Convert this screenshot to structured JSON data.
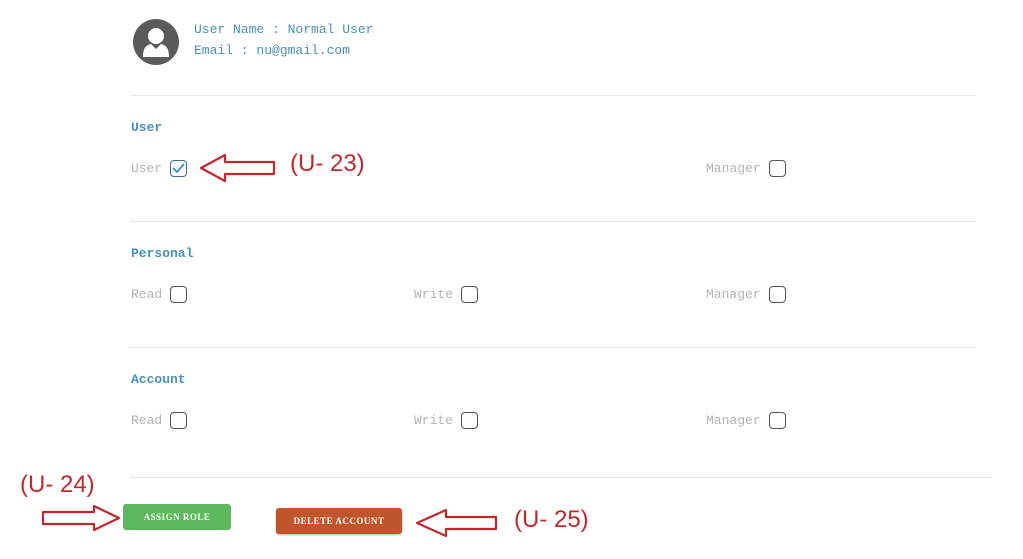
{
  "user": {
    "name_line": "User Name : Normal User",
    "email_line": "Email : nu@gmail.com",
    "avatar_icon": "user-avatar-icon"
  },
  "sections": [
    {
      "title": "User",
      "permissions": [
        {
          "label": "User",
          "checked": true
        },
        {
          "label": "Manager",
          "checked": false
        }
      ]
    },
    {
      "title": "Personal",
      "permissions": [
        {
          "label": "Read",
          "checked": false
        },
        {
          "label": "Write",
          "checked": false
        },
        {
          "label": "Manager",
          "checked": false
        }
      ]
    },
    {
      "title": "Account",
      "permissions": [
        {
          "label": "Read",
          "checked": false
        },
        {
          "label": "Write",
          "checked": false
        },
        {
          "label": "Manager",
          "checked": false
        }
      ]
    }
  ],
  "buttons": {
    "assign_label": "ASSIGN ROLE",
    "delete_label": "DELETE ACCOUNT"
  },
  "annotations": {
    "u23": "(U- 23)",
    "u24": "(U- 24)",
    "u25": "(U- 25)"
  },
  "colors": {
    "accent": "#4a90b8",
    "assign": "#5cb85c",
    "delete": "#c0552b",
    "annotation": "#c0282d"
  }
}
